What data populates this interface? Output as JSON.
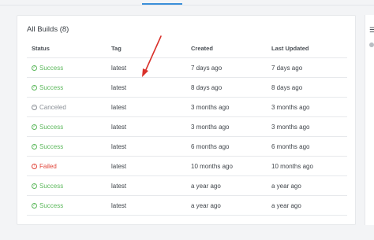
{
  "card": {
    "title": "All Builds (8)"
  },
  "columns": [
    "Status",
    "Tag",
    "Created",
    "Last Updated"
  ],
  "rows": [
    {
      "status": "Success",
      "status_type": "success",
      "tag": "latest",
      "created": "7 days ago",
      "updated": "7 days ago"
    },
    {
      "status": "Success",
      "status_type": "success",
      "tag": "latest",
      "created": "8 days ago",
      "updated": "8 days ago"
    },
    {
      "status": "Canceled",
      "status_type": "canceled",
      "tag": "latest",
      "created": "3 months ago",
      "updated": "3 months ago"
    },
    {
      "status": "Success",
      "status_type": "success",
      "tag": "latest",
      "created": "3 months ago",
      "updated": "3 months ago"
    },
    {
      "status": "Success",
      "status_type": "success",
      "tag": "latest",
      "created": "6 months ago",
      "updated": "6 months ago"
    },
    {
      "status": "Failed",
      "status_type": "failed",
      "tag": "latest",
      "created": "10 months ago",
      "updated": "10 months ago"
    },
    {
      "status": "Success",
      "status_type": "success",
      "tag": "latest",
      "created": "a year ago",
      "updated": "a year ago"
    },
    {
      "status": "Success",
      "status_type": "success",
      "tag": "latest",
      "created": "a year ago",
      "updated": "a year ago"
    }
  ],
  "icons": {
    "success": "check-circle-icon",
    "canceled": "minus-circle-icon",
    "failed": "exclamation-circle-icon"
  },
  "colors": {
    "success": "#5cb85c",
    "canceled": "#8a8f96",
    "failed": "#e0453a",
    "accent": "#3b8fd9",
    "annotation_arrow": "#d9312b"
  }
}
